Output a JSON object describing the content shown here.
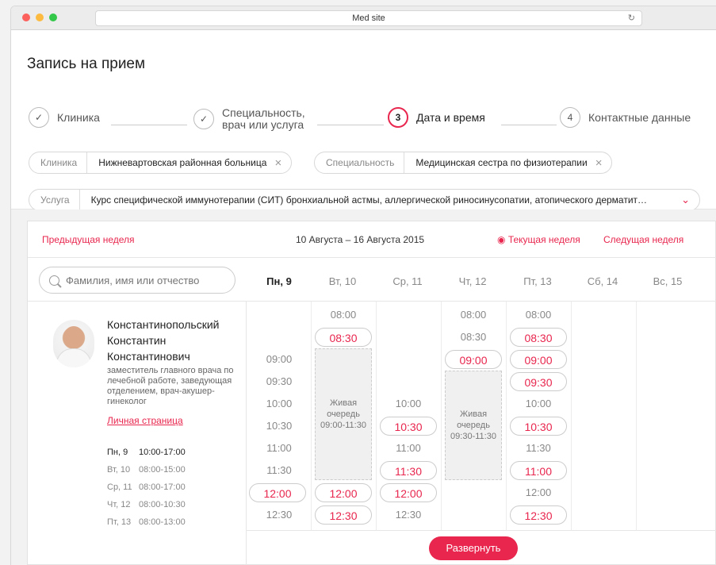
{
  "browser": {
    "url_title": "Med site"
  },
  "page": {
    "title": "Запись на прием"
  },
  "steps": [
    {
      "num": "✓",
      "label": "Клиника"
    },
    {
      "num": "✓",
      "label": "Специальность,\nврач или услуга"
    },
    {
      "num": "3",
      "label": "Дата и время"
    },
    {
      "num": "4",
      "label": "Контактные данные"
    }
  ],
  "filters": {
    "clinic_key": "Клиника",
    "clinic_val": "Нижневартовская районная больница",
    "spec_key": "Специальность",
    "spec_val": "Медицинская сестра по физиотерапии",
    "service_key": "Услуга",
    "service_val": "Курс специфической иммунотерапии (СИТ) бронхиальной астмы, аллергической риносинусопатии, атопического дерматит…"
  },
  "week": {
    "prev": "Предыдущая неделя",
    "range": "10 Августа – 16 Августа 2015",
    "current": "Текущая неделя",
    "next": "Следущая неделя"
  },
  "search": {
    "placeholder": "Фамилия, имя или отчество"
  },
  "days": [
    "Пн, 9",
    "Вт, 10",
    "Ср, 11",
    "Чт, 12",
    "Пт, 13",
    "Сб, 14",
    "Вс, 15"
  ],
  "doctor": {
    "name": "Константинопольский\nКонстантин\nКонстантинович",
    "role": "заместитель главного врача по лечебной работе, заведующая отделением, врач-акушер-гинеколог",
    "link": "Личная страница",
    "schedule": [
      {
        "day": "Пн, 9",
        "hours": "10:00-17:00"
      },
      {
        "day": "Вт, 10",
        "hours": "08:00-15:00"
      },
      {
        "day": "Ср, 11",
        "hours": "08:00-17:00"
      },
      {
        "day": "Чт, 12",
        "hours": "08:00-10:30"
      },
      {
        "day": "Пт, 13",
        "hours": "08:00-13:00"
      }
    ]
  },
  "slots": {
    "mon": [
      {
        "t": "09:00",
        "b": false
      },
      {
        "t": "09:30",
        "b": false
      },
      {
        "t": "10:00",
        "b": false
      },
      {
        "t": "10:30",
        "b": false
      },
      {
        "t": "11:00",
        "b": false
      },
      {
        "t": "11:30",
        "b": false
      },
      {
        "t": "12:00",
        "b": true
      },
      {
        "t": "12:30",
        "b": false
      }
    ],
    "tue": [
      {
        "t": "08:00",
        "b": false
      },
      {
        "t": "08:30",
        "b": true
      },
      {
        "t": "12:00",
        "b": true
      },
      {
        "t": "12:30",
        "b": true
      }
    ],
    "tue_queue": {
      "label": "Живая\nочередь",
      "time": "09:00-11:30"
    },
    "wed": [
      {
        "t": "10:00",
        "b": false
      },
      {
        "t": "10:30",
        "b": true
      },
      {
        "t": "11:00",
        "b": false
      },
      {
        "t": "11:30",
        "b": true
      },
      {
        "t": "12:00",
        "b": true
      },
      {
        "t": "12:30",
        "b": false
      }
    ],
    "thu": [
      {
        "t": "08:00",
        "b": false
      },
      {
        "t": "08:30",
        "b": false
      },
      {
        "t": "09:00",
        "b": true
      }
    ],
    "thu_queue": {
      "label": "Живая\nочередь",
      "time": "09:30-11:30"
    },
    "fri": [
      {
        "t": "08:00",
        "b": false
      },
      {
        "t": "08:30",
        "b": true
      },
      {
        "t": "09:00",
        "b": true
      },
      {
        "t": "09:30",
        "b": true
      },
      {
        "t": "10:00",
        "b": false
      },
      {
        "t": "10:30",
        "b": true
      },
      {
        "t": "11:30",
        "b": false
      },
      {
        "t": "11:00",
        "b": true
      },
      {
        "t": "12:00",
        "b": false
      },
      {
        "t": "12:30",
        "b": true
      }
    ]
  },
  "expand_label": "Развернуть"
}
